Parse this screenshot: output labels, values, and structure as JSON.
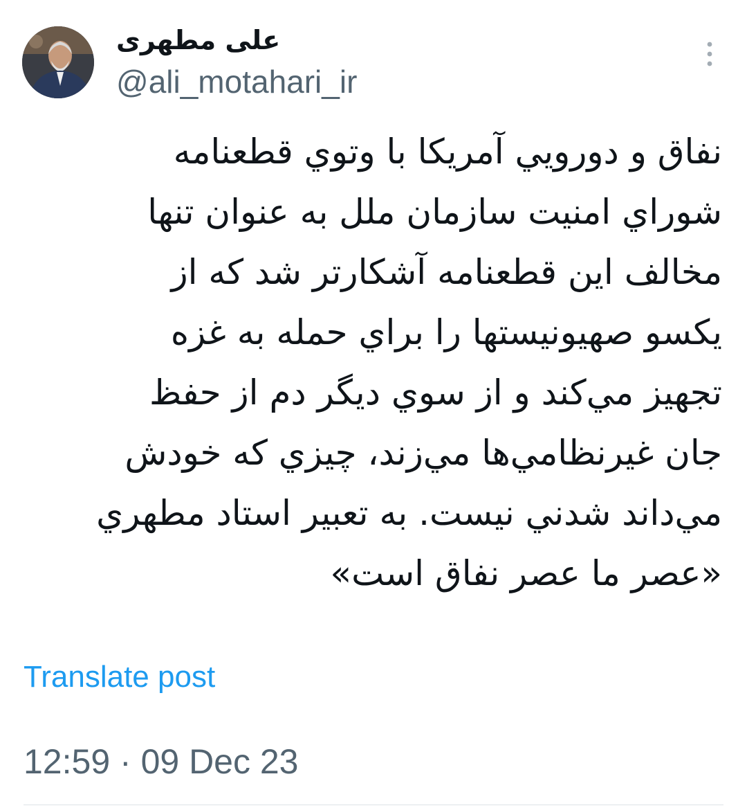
{
  "author": {
    "display_name": "علی مطهری",
    "handle": "@ali_motahari_ir",
    "avatar_icon": "profile-photo"
  },
  "post": {
    "lines": [
      "نفاق و دورويي آمريكا با وتوي قطعنامه",
      "شوراي امنيت سازمان ملل به عنوان تنها",
      "مخالف اين قطعنامه آشكارتر شد كه از",
      "يكسو صهيونيستها را براي حمله به غزه",
      "تجهيز مي‌كند و از سوي ديگر دم از حفظ",
      "جان غيرنظامي‌ها مي‌زند، چيزي كه خودش",
      "مي‌داند شدني نيست. به تعبير استاد مطهري",
      "«عصر ما عصر نفاق است»"
    ]
  },
  "actions": {
    "translate_label": "Translate post",
    "more_icon": "more-vertical-icon"
  },
  "meta": {
    "time": "12:59",
    "separator": " · ",
    "date": "09 Dec 23"
  },
  "colors": {
    "text": "#0f1419",
    "secondary": "#536471",
    "link": "#1d9bf0",
    "divider": "#dde3e7"
  }
}
